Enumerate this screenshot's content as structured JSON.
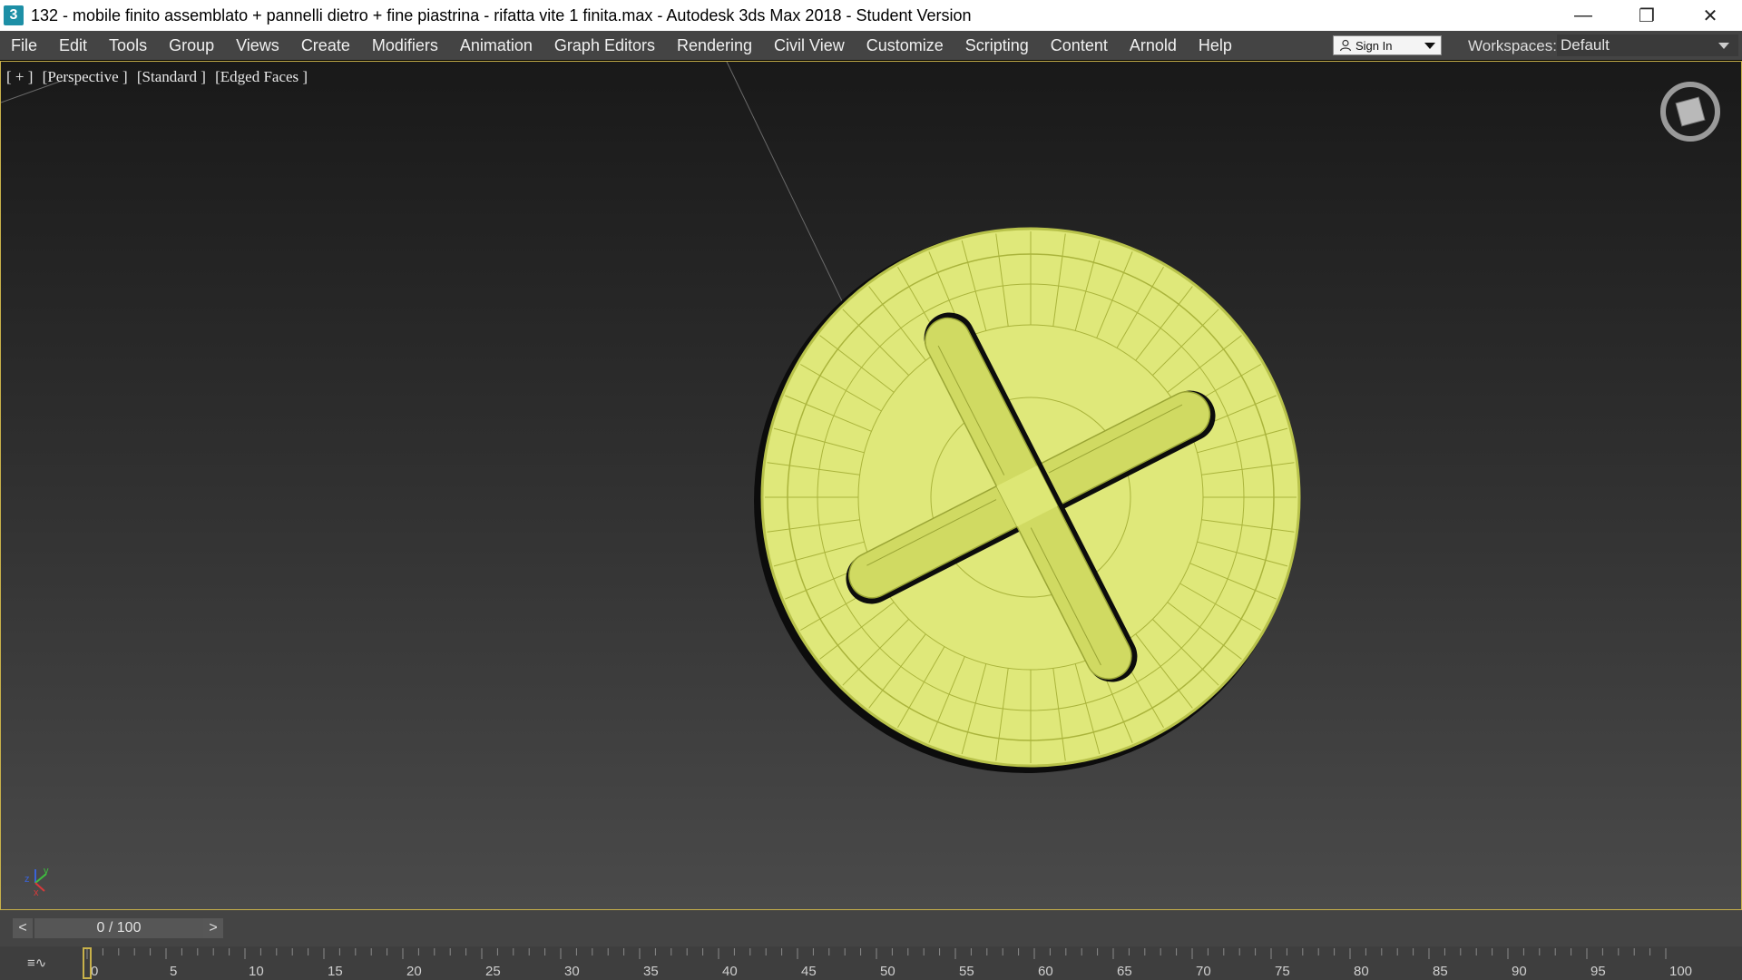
{
  "window": {
    "app_icon": "3",
    "title": "132 -  mobile finito assemblato + pannelli dietro + fine piastrina - rifatta vite 1 finita.max - Autodesk 3ds Max 2018 - Student Version",
    "controls": {
      "minimize": "—",
      "restore": "❐",
      "close": "✕"
    }
  },
  "menu": [
    "File",
    "Edit",
    "Tools",
    "Group",
    "Views",
    "Create",
    "Modifiers",
    "Animation",
    "Graph Editors",
    "Rendering",
    "Civil View",
    "Customize",
    "Scripting",
    "Content",
    "Arnold",
    "Help"
  ],
  "signin": {
    "label": "Sign In",
    "icon": "user-icon"
  },
  "workspaces": {
    "label": "Workspaces:",
    "value": "Default"
  },
  "viewport": {
    "labels": [
      "[ + ]",
      "[Perspective ]",
      "[Standard ]",
      "[Edged Faces ]"
    ],
    "object_color": "#dfe87a",
    "axis": {
      "x": "x",
      "y": "y",
      "z": "z"
    }
  },
  "timeline": {
    "prev": "<",
    "next": ">",
    "position": "0 / 100",
    "current_frame": 0,
    "tick_labels": [
      "0",
      "5",
      "10",
      "15",
      "20",
      "25",
      "30",
      "35",
      "40",
      "45",
      "50",
      "55",
      "60",
      "65",
      "70",
      "75",
      "80",
      "85",
      "90",
      "95",
      "100"
    ]
  },
  "colors": {
    "accent": "#c8b14a",
    "menu_bg": "#444444"
  }
}
